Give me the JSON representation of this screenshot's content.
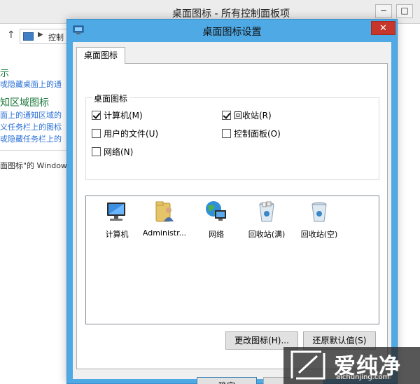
{
  "background_window": {
    "title": "桌面图标 - 所有控制面板项",
    "minimize_label": "─",
    "maximize_label": "□",
    "address": {
      "up_arrow": "↑",
      "crumb_arrow": "▶",
      "crumb": "控制"
    },
    "left_panel": {
      "heading_1": "示",
      "link_1": "戓隐藏桌面上的通",
      "heading_2": "知区域图标",
      "link_2": "面上的通知区域的",
      "link_3": "义任务栏上的图标",
      "link_4": "戓隐藏任务栏上的",
      "note": "面图标\"的 Windows"
    }
  },
  "dialog": {
    "title": "桌面图标设置",
    "close_label": "✕",
    "tab_label": "桌面图标",
    "group_title": "桌面图标",
    "checkboxes": {
      "computer": {
        "label": "计算机(M)",
        "checked": true
      },
      "user_files": {
        "label": "用户的文件(U)",
        "checked": false
      },
      "network": {
        "label": "网络(N)",
        "checked": false
      },
      "recycle_bin": {
        "label": "回收站(R)",
        "checked": true
      },
      "control_panel": {
        "label": "控制面板(O)",
        "checked": false
      }
    },
    "icons": {
      "computer": "计算机",
      "administrator": "Administr...",
      "network": "网络",
      "recycle_full": "回收站(满)",
      "recycle_empty": "回收站(空)"
    },
    "buttons": {
      "change_icon": "更改图标(H)...",
      "restore_default": "还原默认值(S)",
      "ok": "确定",
      "cancel": ""
    }
  },
  "watermark": {
    "title": "爱纯净",
    "url": "aichunjing.com"
  },
  "colors": {
    "dialog_frame": "#4ea9e5",
    "close_button": "#c7362b",
    "link_blue": "#2a6fd6",
    "heading_green": "#1e7a3e"
  }
}
